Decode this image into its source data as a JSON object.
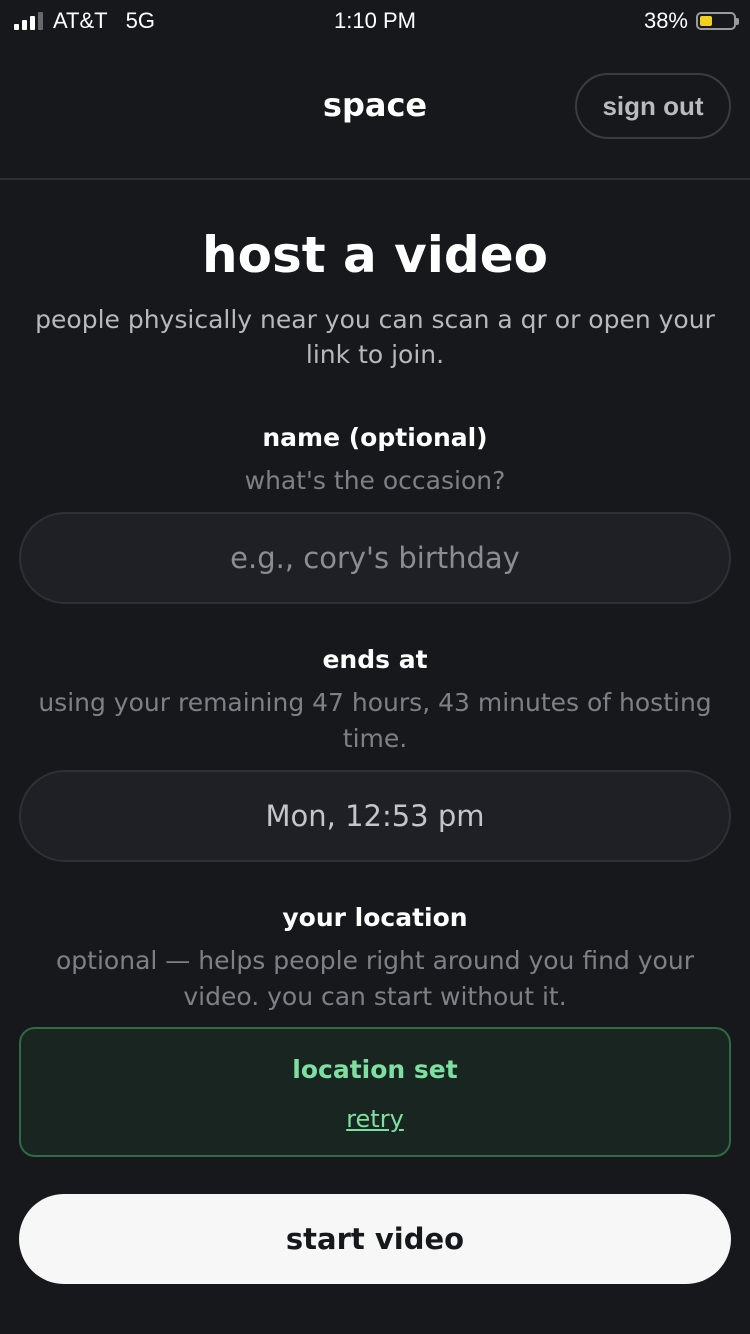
{
  "status_bar": {
    "carrier": "AT&T",
    "network": "5G",
    "time": "1:10 PM",
    "battery_percent": "38%",
    "battery_level": 0.38,
    "battery_color": "#f3d11b"
  },
  "header": {
    "brand": "space",
    "sign_out_label": "sign out"
  },
  "main": {
    "title": "host a video",
    "subtitle": "people physically near you can scan a qr or open your link to join.",
    "name_section": {
      "label": "name (optional)",
      "hint": "what's the occasion?",
      "placeholder": "e.g., cory's birthday",
      "value": ""
    },
    "ends_section": {
      "label": "ends at",
      "hint": "using your remaining 47 hours, 43 minutes of hosting time.",
      "value": "Mon, 12:53 pm"
    },
    "location_section": {
      "label": "your location",
      "hint": "optional — helps people right around you find your video. you can start without it.",
      "status": "location set",
      "retry_label": "retry",
      "accent_color": "#7ee0a0"
    },
    "start_button_label": "start video"
  }
}
